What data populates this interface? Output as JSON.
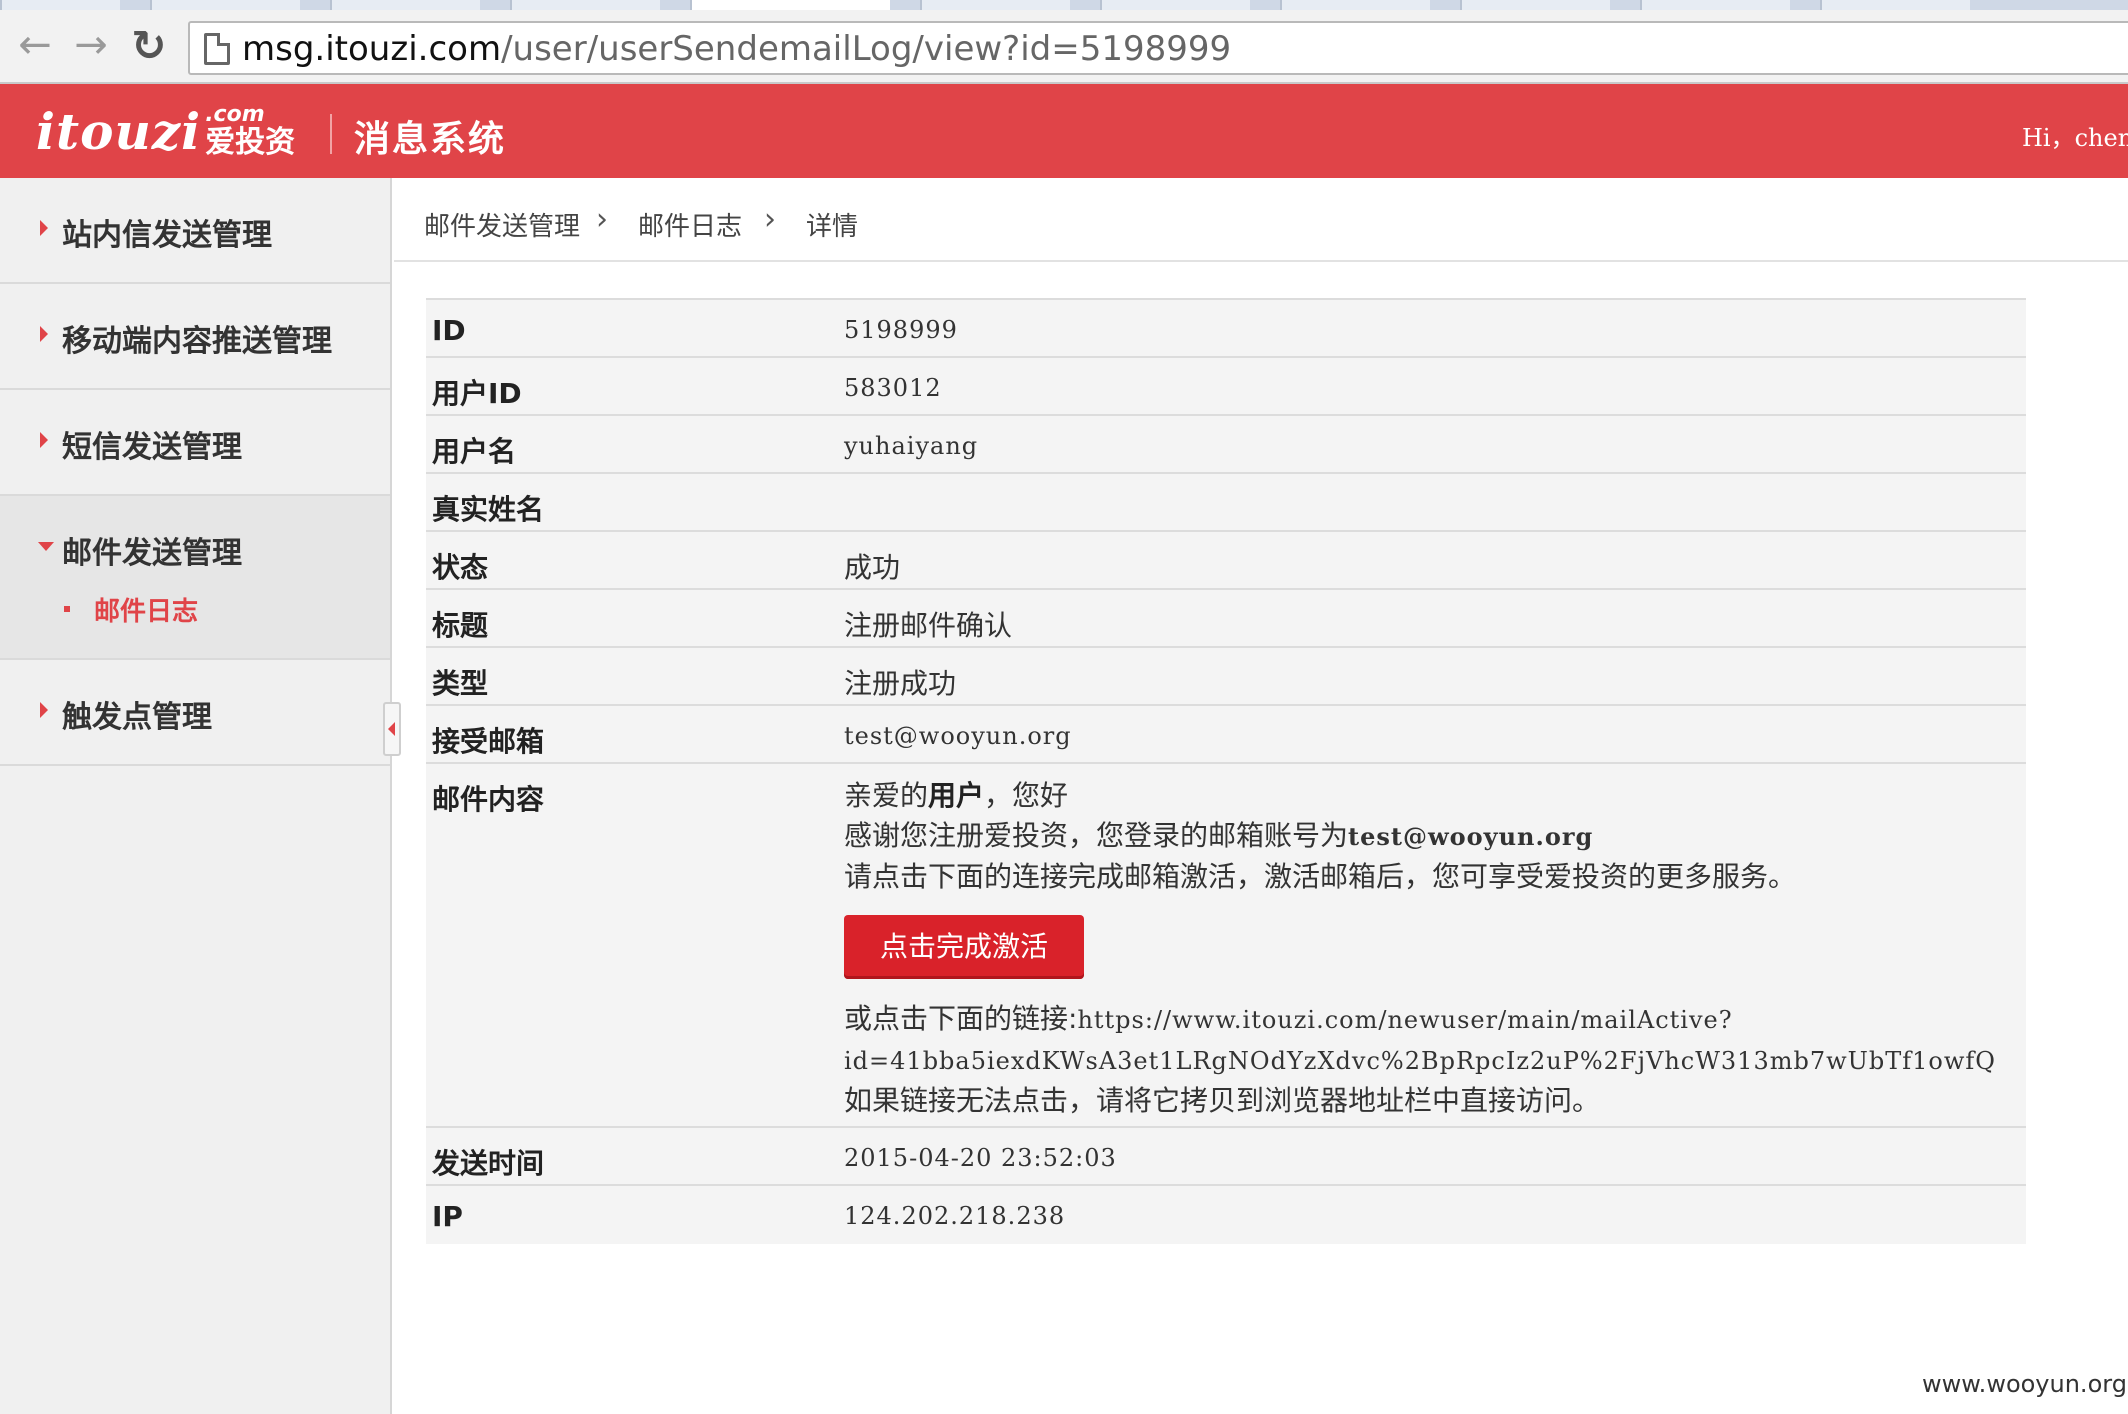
{
  "browser": {
    "url_host": "msg.itouzi.com",
    "url_path": "/user/userSendemailLog/view?id=5198999",
    "back_icon": "arrow-left-icon",
    "forward_icon": "arrow-right-icon",
    "reload_icon": "reload-icon"
  },
  "header": {
    "logo_text": "itouzi",
    "logo_com": ".com",
    "logo_cn": "爱投资",
    "system_title": "消息系统",
    "greeting": "Hi，chen",
    "brand_color": "#e04448"
  },
  "sidebar": {
    "items": [
      {
        "label": "站内信发送管理"
      },
      {
        "label": "移动端内容推送管理"
      },
      {
        "label": "短信发送管理"
      },
      {
        "label": "邮件发送管理",
        "sub": "邮件日志"
      },
      {
        "label": "触发点管理"
      }
    ]
  },
  "breadcrumb": [
    "邮件发送管理",
    "邮件日志",
    "详情"
  ],
  "detail": {
    "id_label": "ID",
    "id_value": "5198999",
    "uid_label": "用户ID",
    "uid_value": "583012",
    "uname_label": "用户名",
    "uname_value": "yuhaiyang",
    "realname_label": "真实姓名",
    "realname_value": "",
    "status_label": "状态",
    "status_value": "成功",
    "title_label": "标题",
    "title_value": "注册邮件确认",
    "type_label": "类型",
    "type_value": "注册成功",
    "email_label": "接受邮箱",
    "email_value": "test@wooyun.org",
    "content_label": "邮件内容",
    "send_time_label": "发送时间",
    "send_time_value": "2015-04-20 23:52:03",
    "ip_label": "IP",
    "ip_value": "124.202.218.238"
  },
  "mail": {
    "greet_prefix": "亲爱的",
    "greet_user": "用户",
    "greet_suffix": "，您好",
    "thanks_prefix": "感谢您注册爱投资，您登录的邮箱账号为",
    "thanks_email": "test@wooyun.org",
    "instruction": "请点击下面的连接完成邮箱激活，激活邮箱后，您可享受爱投资的更多服务。",
    "button_label": "点击完成激活",
    "or_link_prefix": "或点击下面的链接:",
    "link_part1": "https://www.itouzi.com/newuser/main/mailActive?",
    "link_part2": "id=41bba5iexdKWsA3et1LRgNOdYzXdvc%2BpRpcIz2uP%2FjVhcW313mb7wUbTf1owfQ",
    "fallback": "如果链接无法点击，请将它拷贝到浏览器地址栏中直接访问。"
  },
  "watermark": "www.wooyun.org"
}
